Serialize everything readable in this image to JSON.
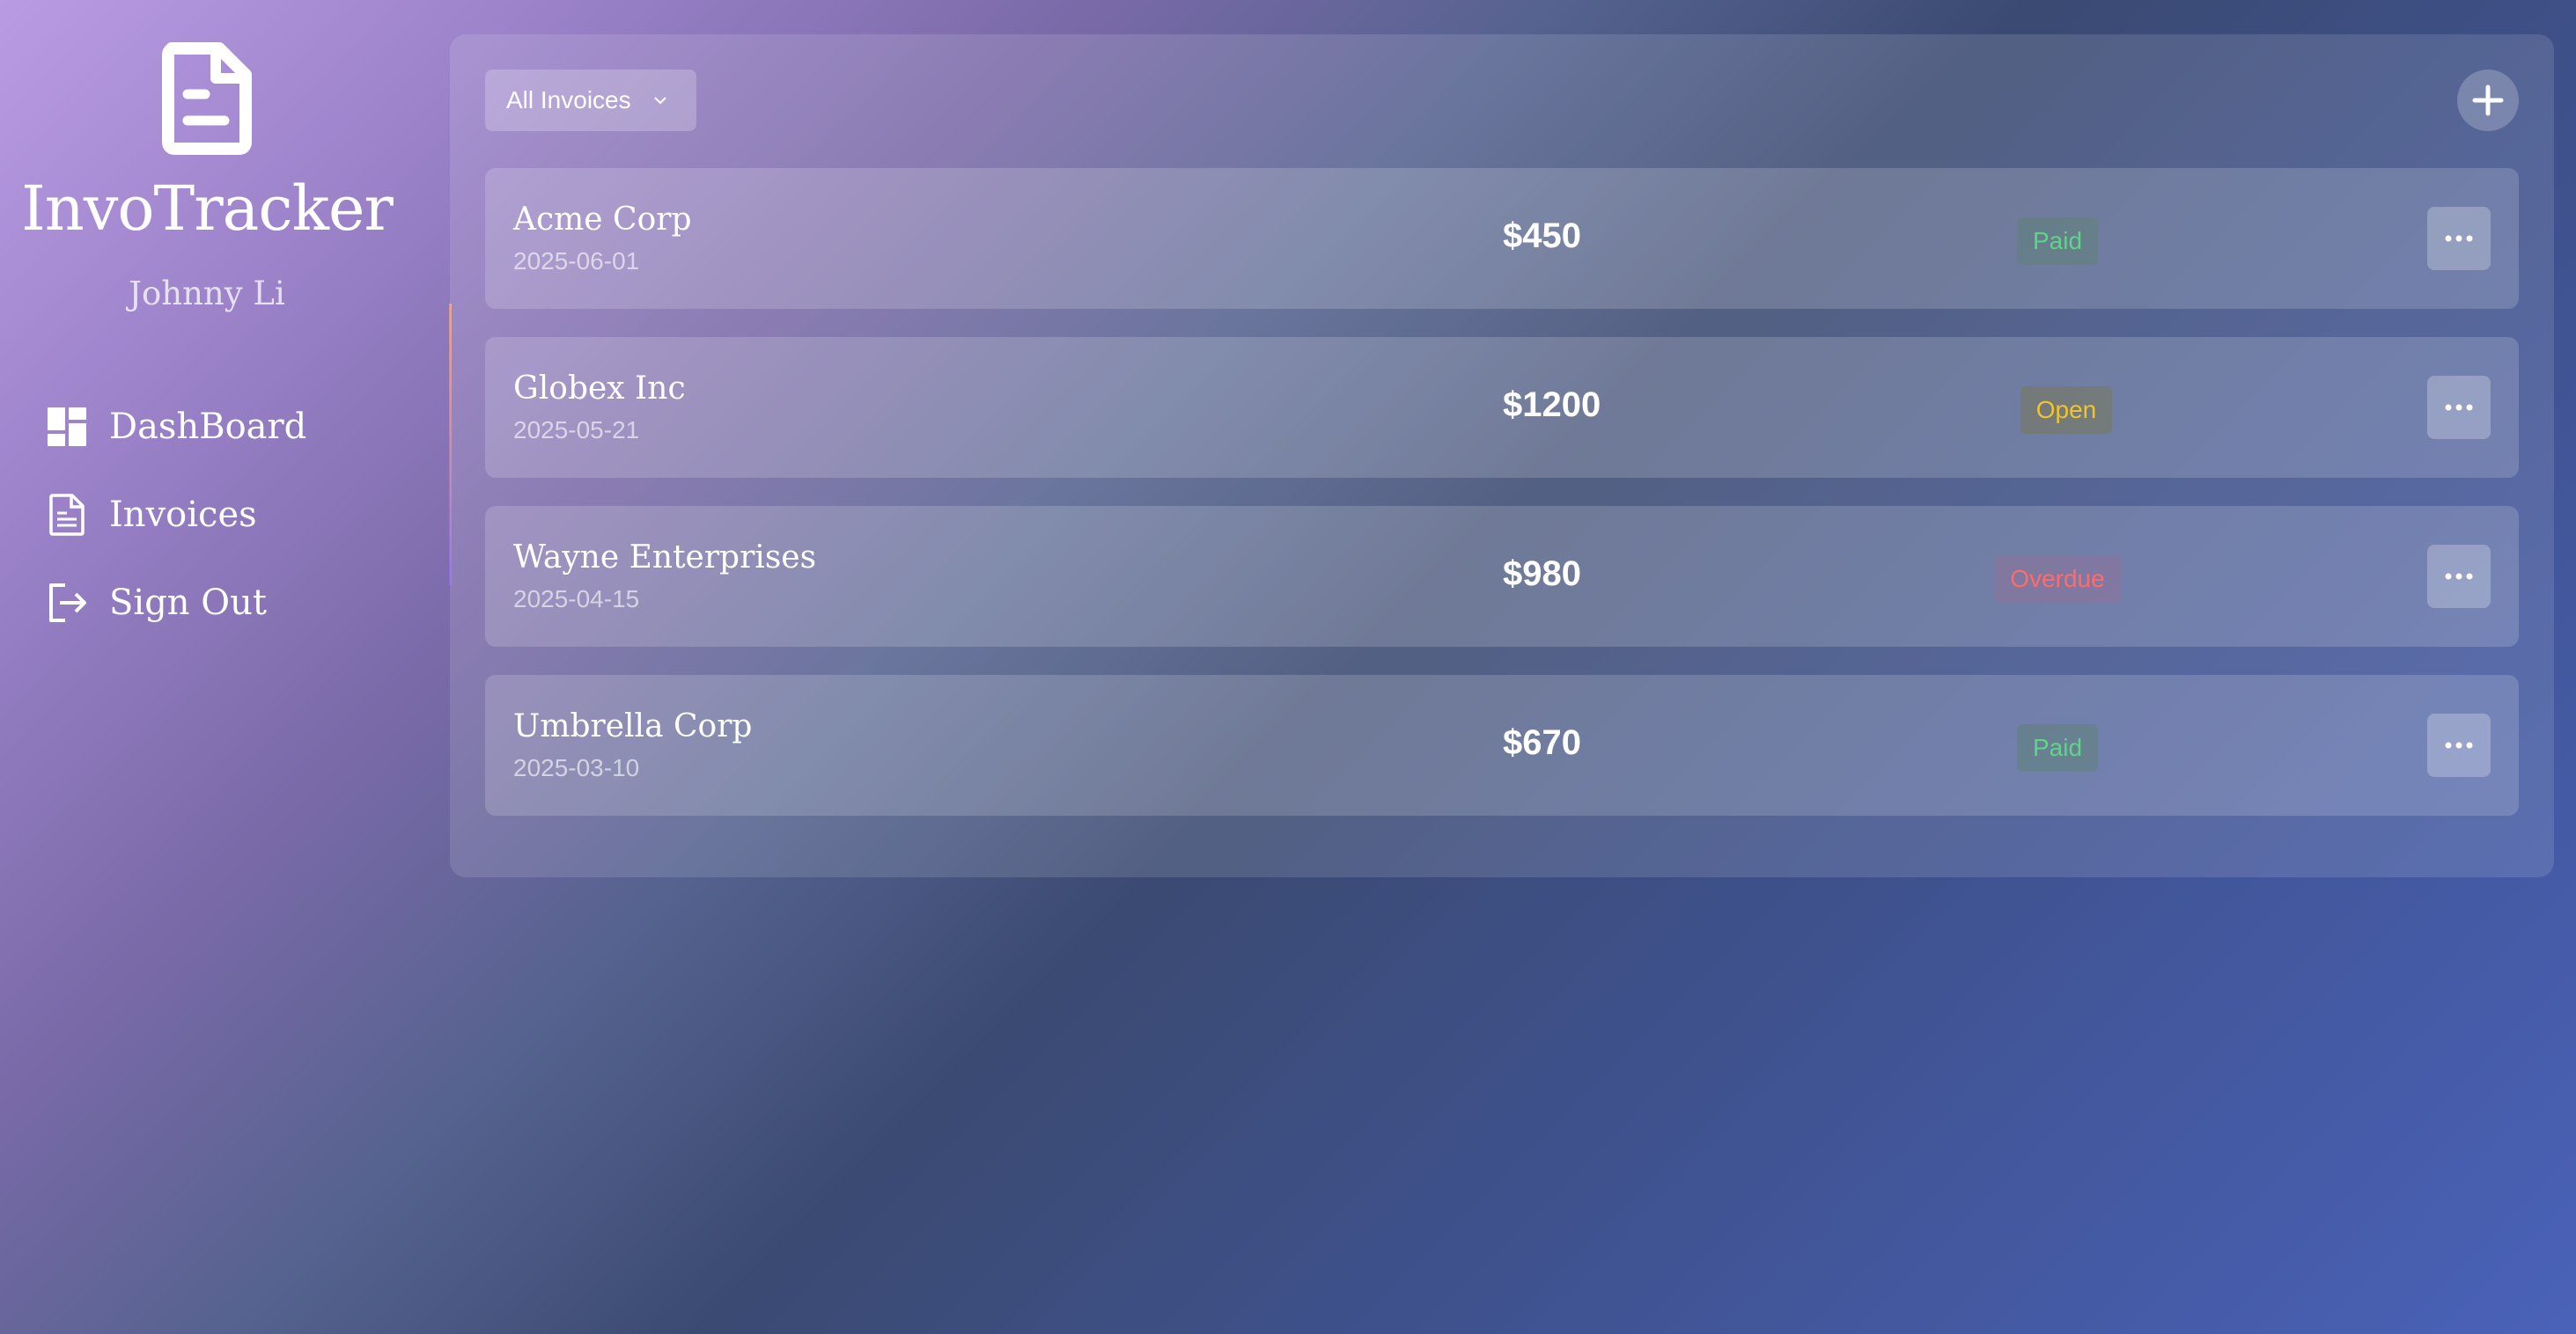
{
  "app": {
    "title": "InvoTracker",
    "user_name": "Johnny Li",
    "logo_icon": "invoice-document-icon"
  },
  "sidebar": {
    "items": [
      {
        "label": "DashBoard",
        "icon": "dashboard-grid-icon"
      },
      {
        "label": "Invoices",
        "icon": "document-icon"
      },
      {
        "label": "Sign Out",
        "icon": "sign-out-icon"
      }
    ]
  },
  "toolbar": {
    "filter_label": "All Invoices",
    "filter_icon": "chevron-down-icon",
    "add_icon": "plus-icon"
  },
  "invoices": [
    {
      "client": "Acme Corp",
      "date": "2025-06-01",
      "amount": "$450",
      "status": "Paid",
      "status_color": "#5fd38a"
    },
    {
      "client": "Globex Inc",
      "date": "2025-05-21",
      "amount": "$1200",
      "status": "Open",
      "status_color": "#f2c42b"
    },
    {
      "client": "Wayne Enterprises",
      "date": "2025-04-15",
      "amount": "$980",
      "status": "Overdue",
      "status_color": "#ff6b6b"
    },
    {
      "client": "Umbrella Corp",
      "date": "2025-03-10",
      "amount": "$670",
      "status": "Paid",
      "status_color": "#5fd38a"
    }
  ],
  "row_action_icon": "more-horizontal-icon"
}
